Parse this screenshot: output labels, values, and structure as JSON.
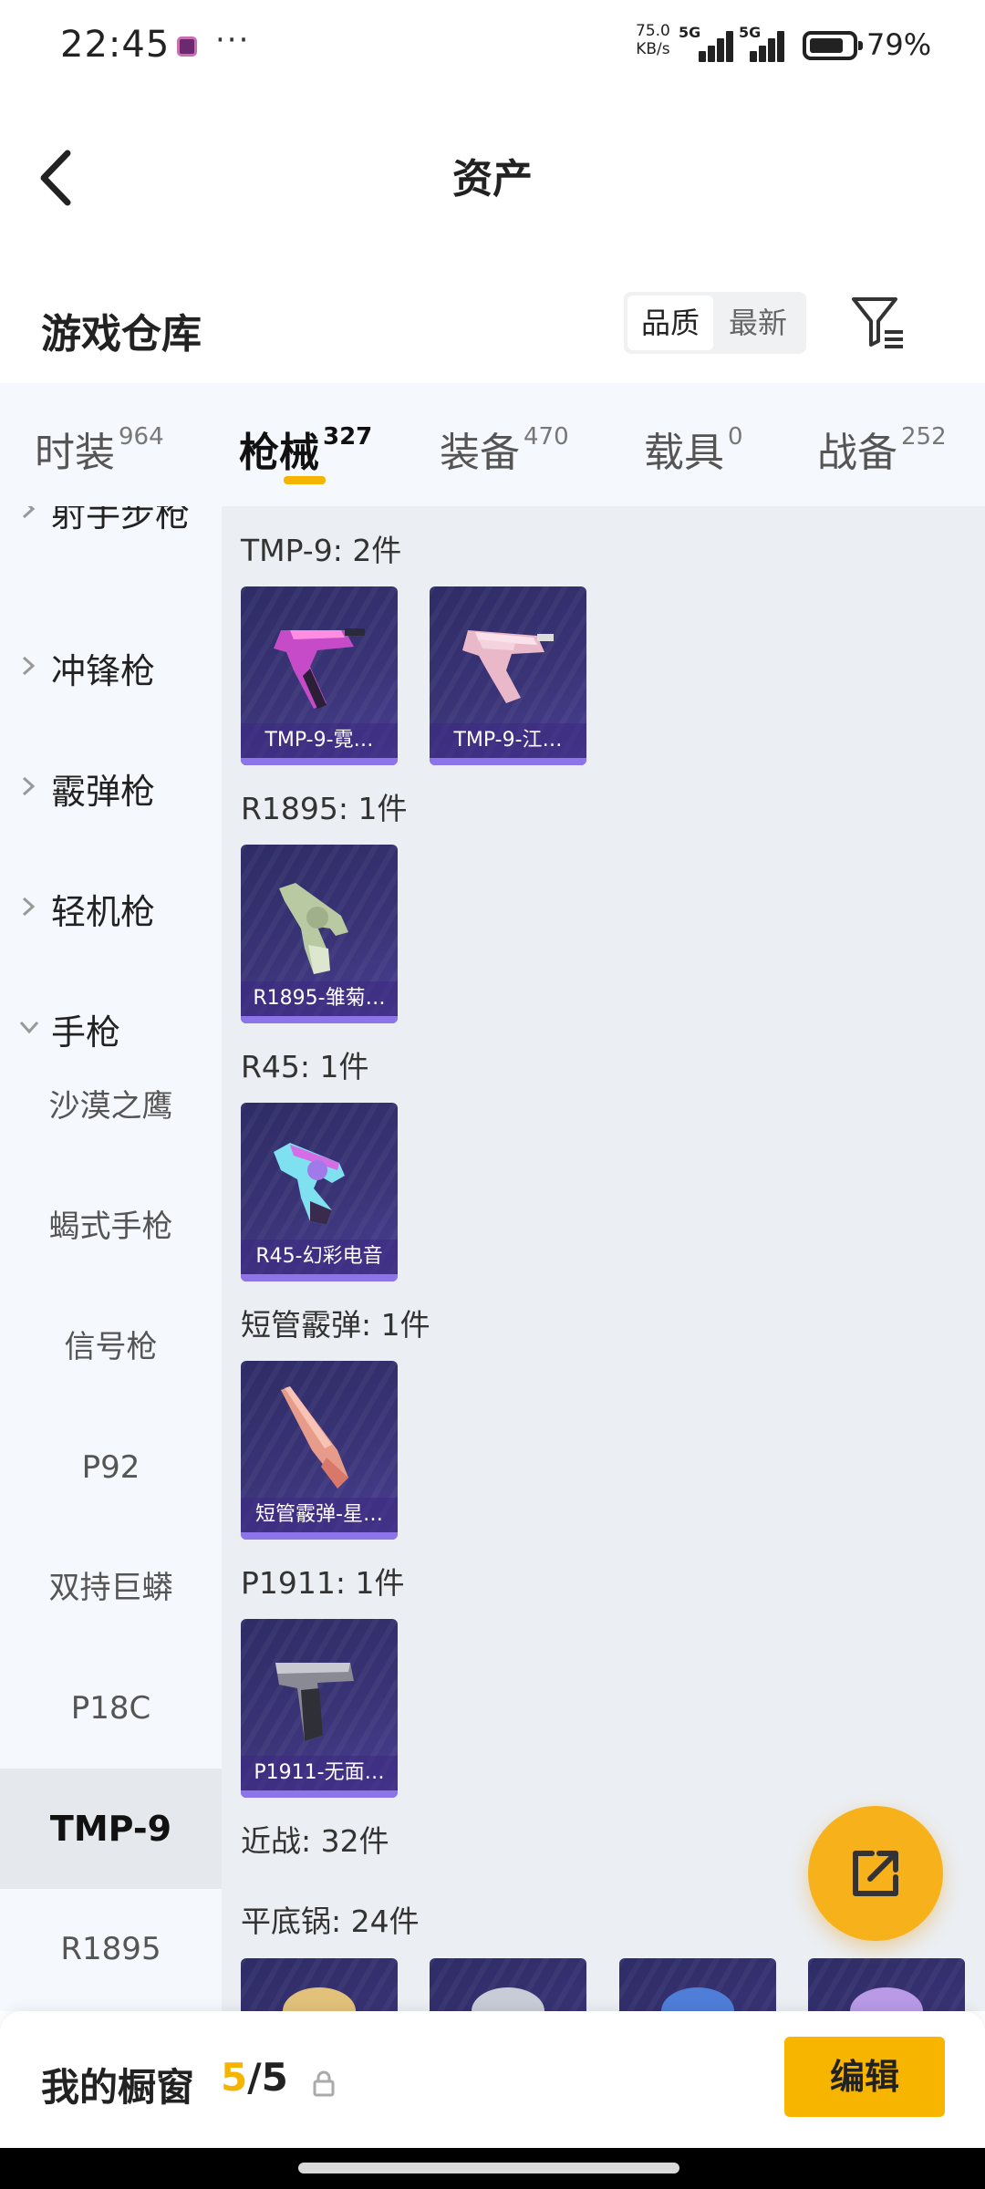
{
  "status_bar": {
    "time": "22:45",
    "more": "···",
    "speed_value": "75.0",
    "speed_unit": "KB/s",
    "network1": "5G",
    "network2": "5G",
    "battery": "79%"
  },
  "header": {
    "title": "资产"
  },
  "warehouse": {
    "title": "游戏仓库",
    "sort_quality": "品质",
    "sort_newest": "最新"
  },
  "tabs": [
    {
      "label": "时装",
      "count": "964"
    },
    {
      "label": "枪械",
      "count": "327"
    },
    {
      "label": "装备",
      "count": "470"
    },
    {
      "label": "载具",
      "count": "0"
    },
    {
      "label": "战备",
      "count": "252"
    }
  ],
  "sidebar": {
    "cut_item": "射手步枪",
    "categories": [
      {
        "label": "冲锋枪"
      },
      {
        "label": "霰弹枪"
      },
      {
        "label": "轻机枪"
      },
      {
        "label": "手枪"
      }
    ],
    "sub_items": [
      {
        "label": "沙漠之鹰"
      },
      {
        "label": "蝎式手枪"
      },
      {
        "label": "信号枪"
      },
      {
        "label": "P92"
      },
      {
        "label": "双持巨蟒"
      },
      {
        "label": "P18C"
      },
      {
        "label": "TMP-9"
      },
      {
        "label": "R1895"
      }
    ]
  },
  "groups": [
    {
      "title": "TMP-9: 2件",
      "items": [
        "TMP-9-霓…",
        "TMP-9-江…"
      ]
    },
    {
      "title": "R1895: 1件",
      "items": [
        "R1895-雏菊…"
      ]
    },
    {
      "title": "R45: 1件",
      "items": [
        "R45-幻彩电音"
      ]
    },
    {
      "title": "短管霰弹: 1件",
      "items": [
        "短管霰弹-星…"
      ]
    },
    {
      "title": "P1911: 1件",
      "items": [
        "P1911-无面…"
      ]
    },
    {
      "title": "近战: 32件",
      "items": []
    },
    {
      "title": "平底锅: 24件",
      "items": []
    }
  ],
  "bottom": {
    "title": "我的橱窗",
    "current": "5",
    "total": "/5",
    "edit": "编辑"
  },
  "colors": {
    "accent": "#f5b400",
    "card_bg": "#3a3477",
    "card_stripe": "#8d74e8"
  }
}
